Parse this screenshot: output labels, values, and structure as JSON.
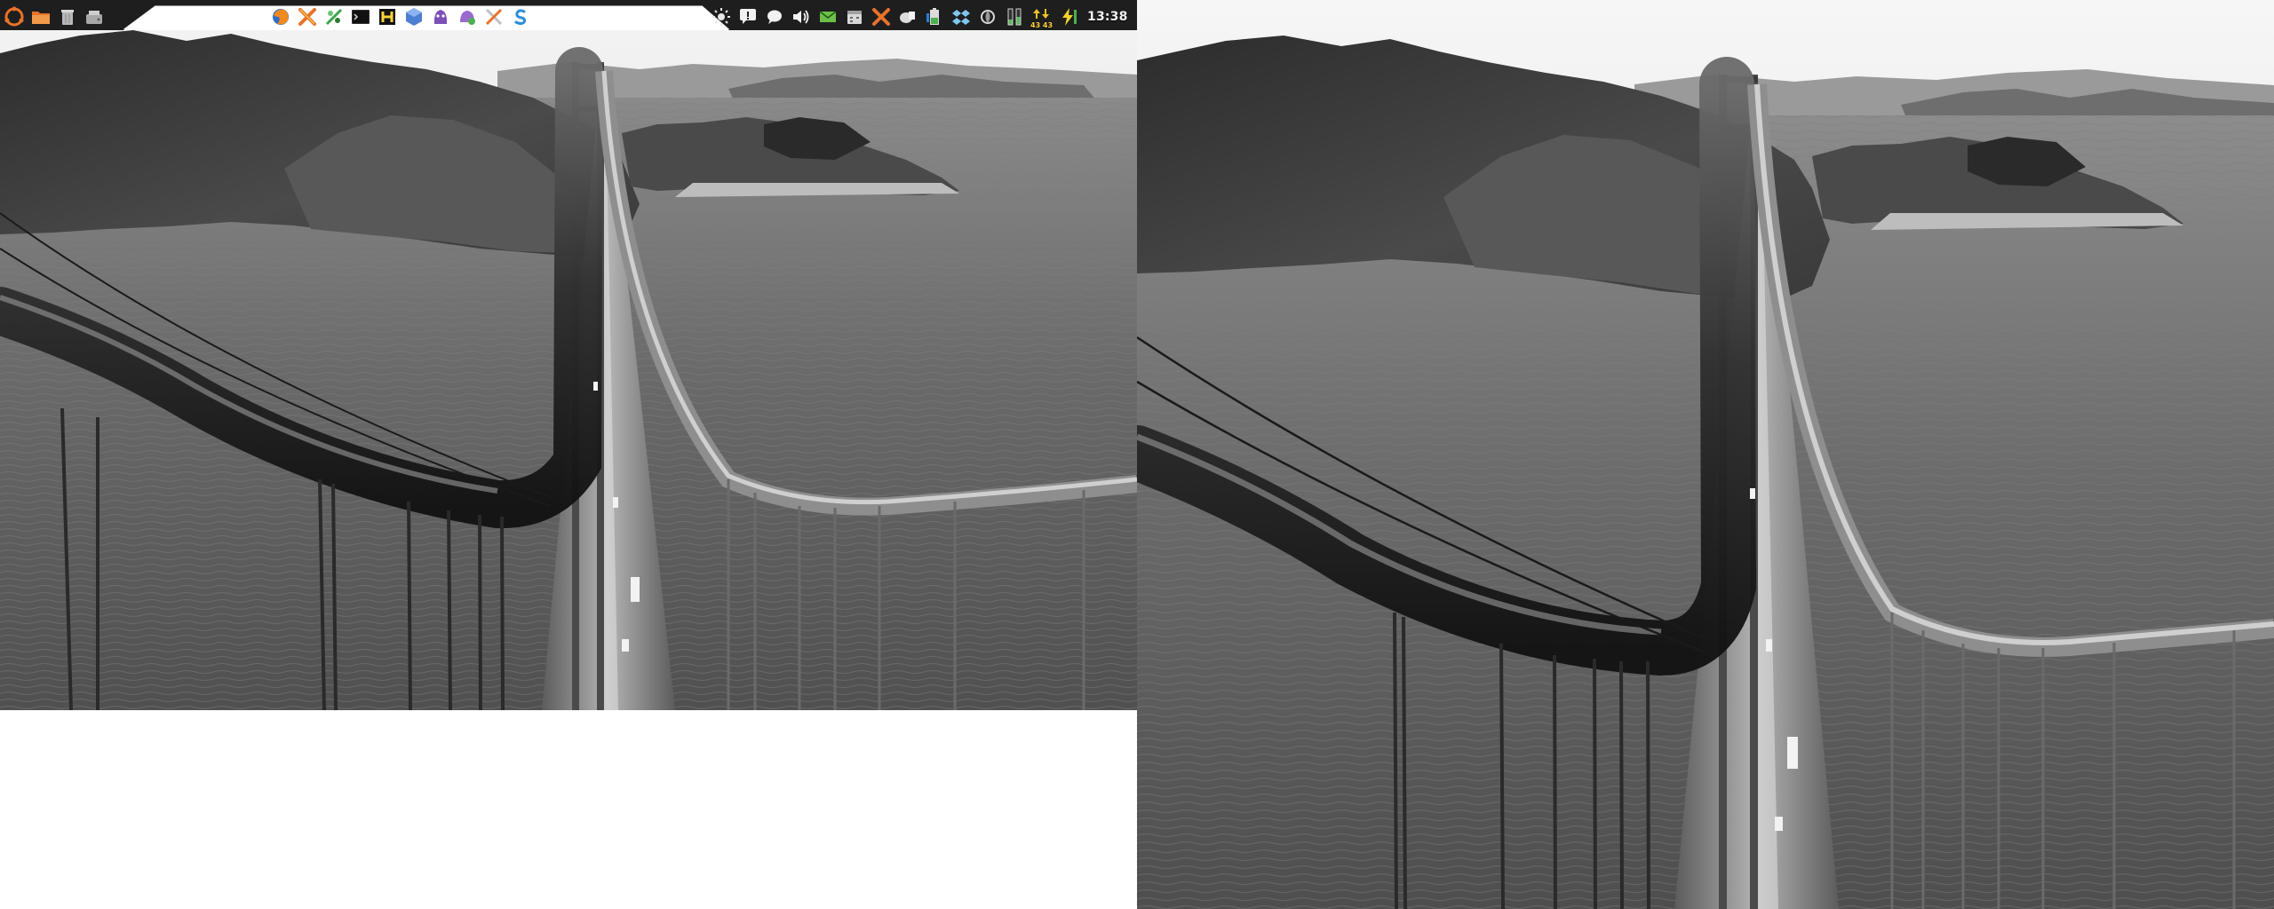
{
  "panel": {
    "clock": "13:38",
    "net_speed": "43 43"
  },
  "icons": {
    "left": [
      "ubuntu-logo-icon",
      "folder-icon",
      "trash-icon",
      "drive-icon"
    ],
    "launchers": [
      "firefox-icon",
      "tools-icon",
      "scripts-icon",
      "terminal-icon",
      "hexchat-icon",
      "virtualbox-icon",
      "pidgin-icon",
      "empathy-icon",
      "settings-icon",
      "skype-icon"
    ],
    "tray": [
      "brightness-icon",
      "notification-icon",
      "chat-bubble-icon",
      "volume-icon",
      "mail-icon",
      "calendar-icon",
      "tools-icon",
      "clipboard-icon",
      "battery-icon",
      "dropbox-icon",
      "network-icon",
      "cpu-meter-icon",
      "network-speed-icon",
      "power-indicator-icon",
      "shutdown-icon"
    ]
  },
  "colors": {
    "panel": "#1e1e1e",
    "panel_divider": "#ffffff",
    "sky": "#dcdcdc",
    "water": "#5a5a5a",
    "hills": "#3a3a3a",
    "bridge_deck": "#9a9a9a"
  }
}
